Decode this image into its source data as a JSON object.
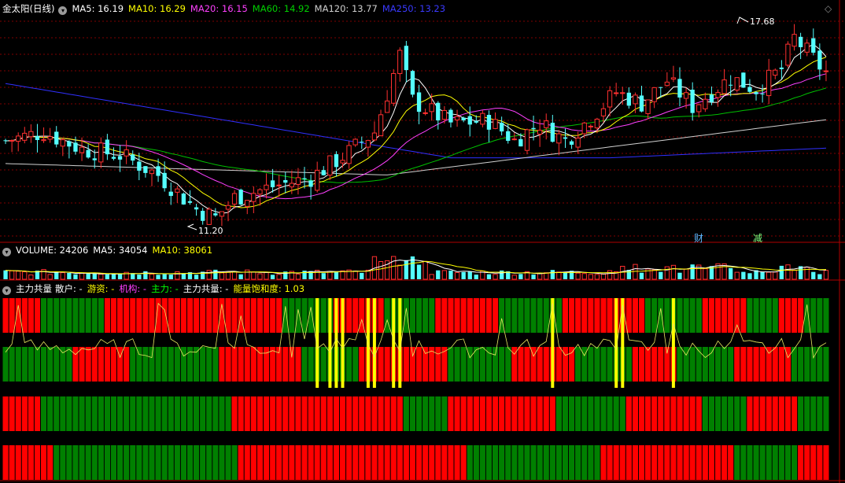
{
  "main_header": {
    "title": "金太阳(日线)",
    "ma5": "MA5: 16.19",
    "ma10": "MA10: 16.29",
    "ma20": "MA20: 16.15",
    "ma60": "MA60: 14.92",
    "ma120": "MA120: 13.77",
    "ma250": "MA250: 13.23"
  },
  "annotations": {
    "high_label": "17.68",
    "low_label": "11.20",
    "badge_cai": "财",
    "badge_jian": "减"
  },
  "volume_header": {
    "volume": "VOLUME: 24206",
    "ma5": "MA5: 34054",
    "ma10": "MA10: 38061"
  },
  "indicator_header": {
    "name": "主力共量",
    "sanhu": "散户: -",
    "youzi": "游资: -",
    "jigou": "机构: -",
    "zhuli": "主力: -",
    "zhuligongliang": "主力共量: -",
    "saturation": "能量饱和度: 1.03"
  },
  "colors": {
    "up": "#ff3030",
    "down": "#54ffff",
    "ma5": "#ffffff",
    "ma10": "#ffff00",
    "ma20": "#ff40ff",
    "ma60": "#00c000",
    "ma120": "#d0d0d0",
    "ma250": "#3030ff",
    "grid": "#800000",
    "bar_red": "#ff0000",
    "bar_green": "#008000",
    "bar_yellow": "#ffff00"
  },
  "chart_data": {
    "type": "candlestick",
    "price_range": [
      10.5,
      18.4
    ],
    "high": 17.68,
    "low": 11.2,
    "candles": 130
  }
}
